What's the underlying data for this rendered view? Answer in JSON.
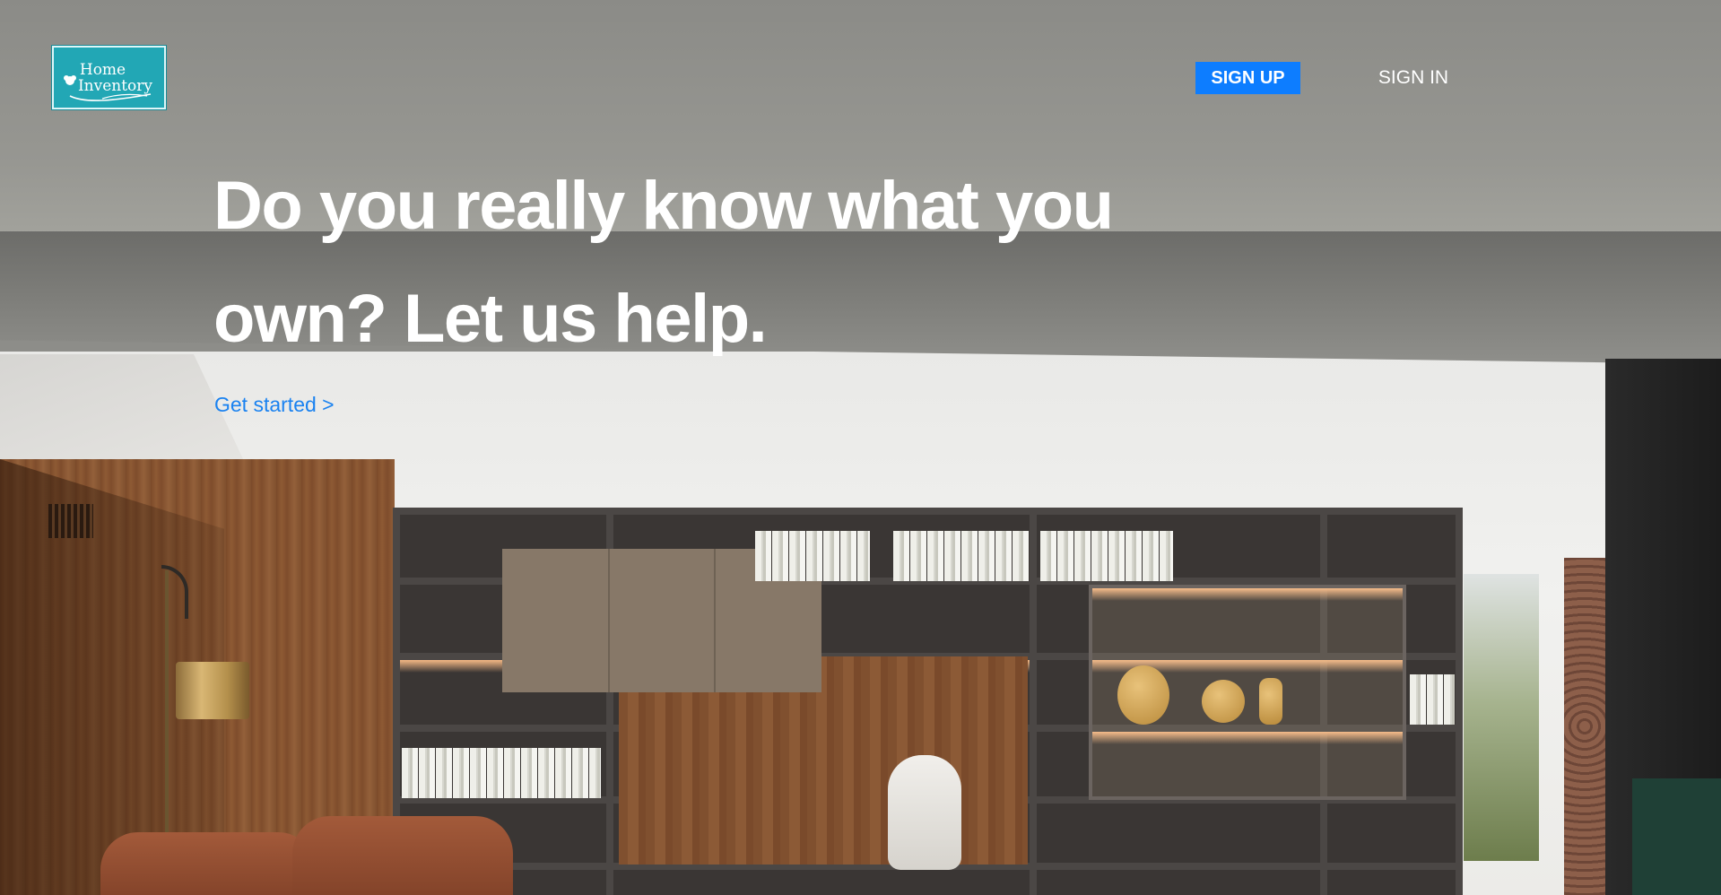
{
  "brand": {
    "logo_line1": "Home",
    "logo_line2": "Inventory",
    "logo_color": "#22a7b5",
    "logo_icon": "flower-swoosh-icon"
  },
  "nav": {
    "signup_label": "SIGN UP",
    "signin_label": "SIGN IN",
    "accent_color": "#0d7dff"
  },
  "hero": {
    "headline_line1": "Do you really know what you",
    "headline_line2": "own? Let us help.",
    "cta_label": "Get started >",
    "cta_color": "#1a82f0",
    "background": "living-room-bookcase-photo"
  }
}
